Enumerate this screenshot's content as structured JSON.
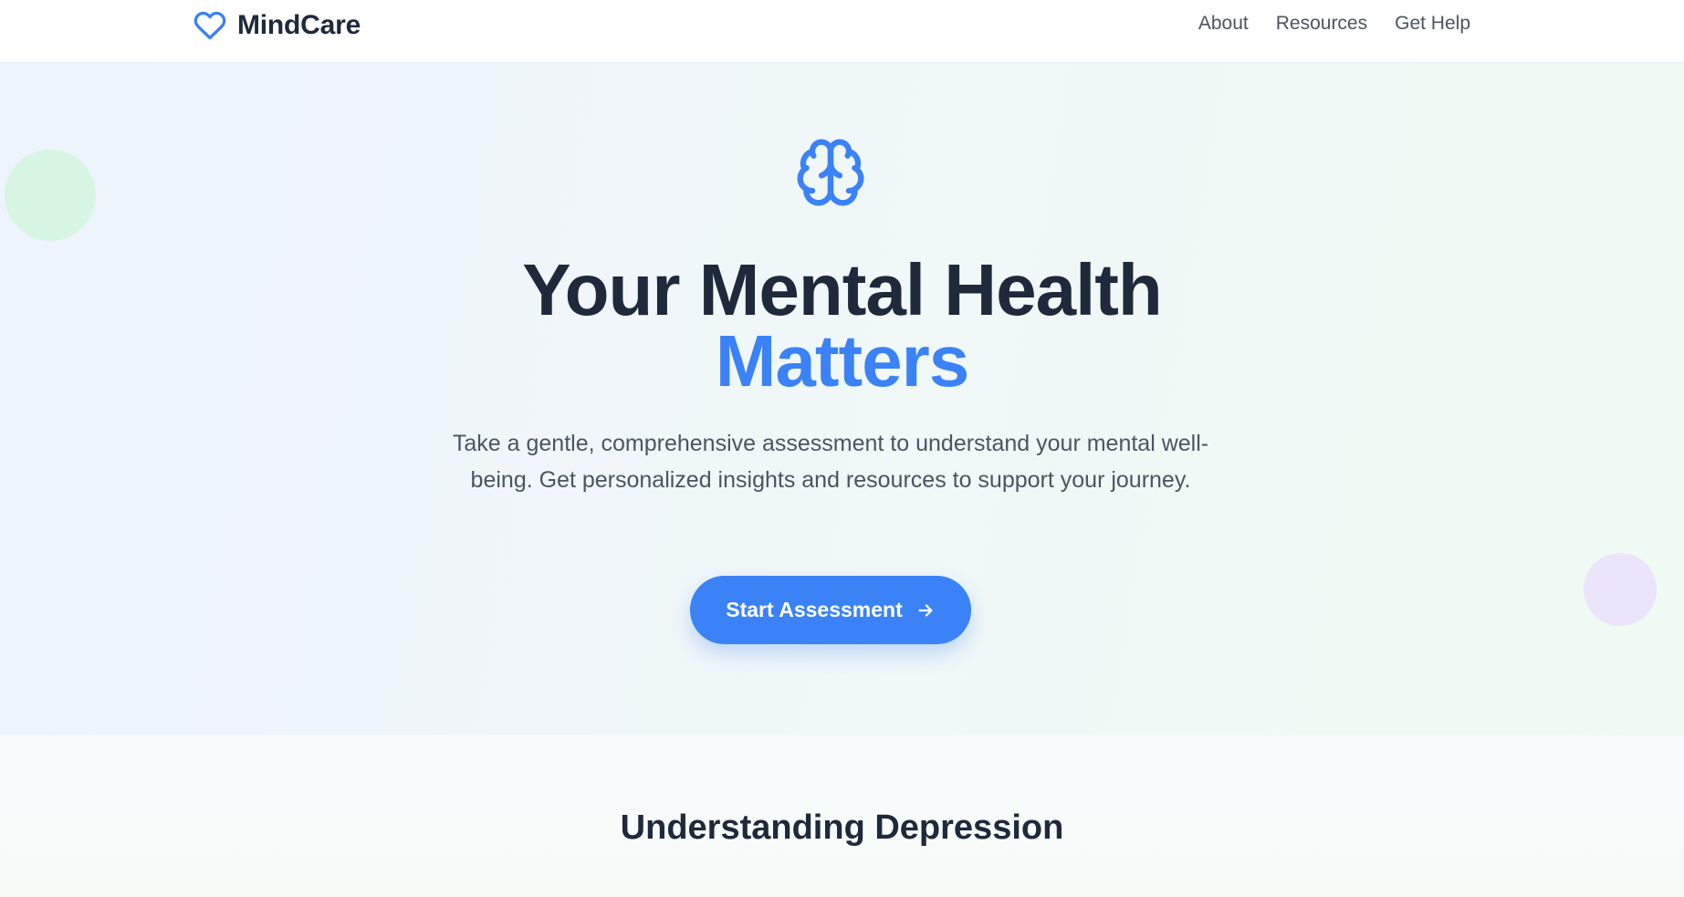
{
  "nav": {
    "brand": "MindCare",
    "brand_icon": "heart-icon",
    "links": [
      "About",
      "Resources",
      "Get Help"
    ]
  },
  "hero": {
    "icon": "brain-icon",
    "title_line1": "Your Mental Health",
    "title_line2": "Matters",
    "subtitle": "Take a gentle, comprehensive assessment to understand your mental well-being. Get personalized insights and resources to support your journey.",
    "cta_label": "Start Assessment",
    "cta_icon": "arrow-right-icon"
  },
  "section": {
    "title": "Understanding Depression"
  },
  "colors": {
    "accent": "#3b82f6",
    "text_dark": "#1e293b",
    "text_muted": "#4b5563",
    "blob_green": "#d6f5e3",
    "blob_purple": "#ebe4fa"
  }
}
